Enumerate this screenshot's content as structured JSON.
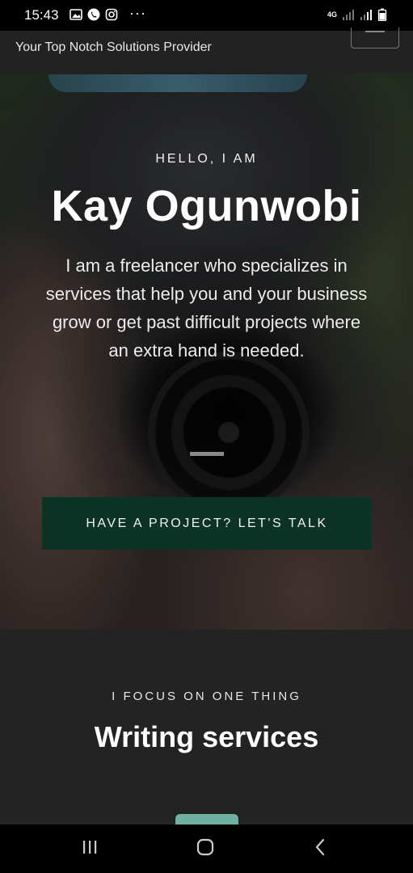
{
  "status_bar": {
    "time": "15:43",
    "dots": "···",
    "network": "4G",
    "icons": [
      "gallery-icon",
      "phone-icon",
      "instagram-icon",
      "signal-icon",
      "signal-icon",
      "battery-icon"
    ]
  },
  "header": {
    "tagline": "Your Top Notch Solutions Provider",
    "menu_icon": "hamburger-menu-icon"
  },
  "hero": {
    "greeting": "HELLO, I AM",
    "name": "Kay Ogunwobi",
    "description": "I am a freelancer who specializes in services that help you and your business grow or get past difficult projects where an extra hand is needed.",
    "cta_label": "HAVE A PROJECT? LET'S TALK"
  },
  "focus": {
    "kicker": "I FOCUS ON ONE THING",
    "title": "Writing services"
  },
  "nav_bar": {
    "icons": [
      "recent-apps-icon",
      "home-icon",
      "back-icon"
    ]
  },
  "colors": {
    "cta_background": "#0c3326",
    "section_background": "#232323",
    "header_background": "#222222",
    "accent_tab": "#6fb0a0"
  }
}
